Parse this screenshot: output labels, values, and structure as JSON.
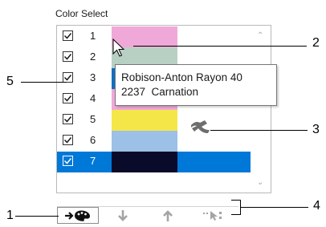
{
  "panel": {
    "title": "Color Select"
  },
  "rows": [
    {
      "number": "1",
      "checked": true,
      "color": "#f0a8d8",
      "selected": false
    },
    {
      "number": "2",
      "checked": true,
      "color": "#b8d0c4",
      "selected": false
    },
    {
      "number": "3",
      "checked": true,
      "color": "#0f6ec0",
      "selected": false
    },
    {
      "number": "4",
      "checked": true,
      "color": "#f0a8d8",
      "selected": false
    },
    {
      "number": "5",
      "checked": true,
      "color": "#f4e648",
      "selected": false
    },
    {
      "number": "6",
      "checked": true,
      "color": "#9cc0e6",
      "selected": false
    },
    {
      "number": "7",
      "checked": true,
      "color": "#0a0a2a",
      "selected": true
    }
  ],
  "tooltip": {
    "line1": "Robison-Anton Rayon 40",
    "line2": "2237  Carnation"
  },
  "toolbar": {
    "buttons": [
      {
        "icon": "assign-color-icon"
      },
      {
        "icon": "arrow-down-icon"
      },
      {
        "icon": "arrow-up-icon"
      },
      {
        "icon": "select-region-icon"
      }
    ]
  },
  "callouts": {
    "c1": "1",
    "c2": "2",
    "c3": "3",
    "c4": "4",
    "c5": "5"
  }
}
